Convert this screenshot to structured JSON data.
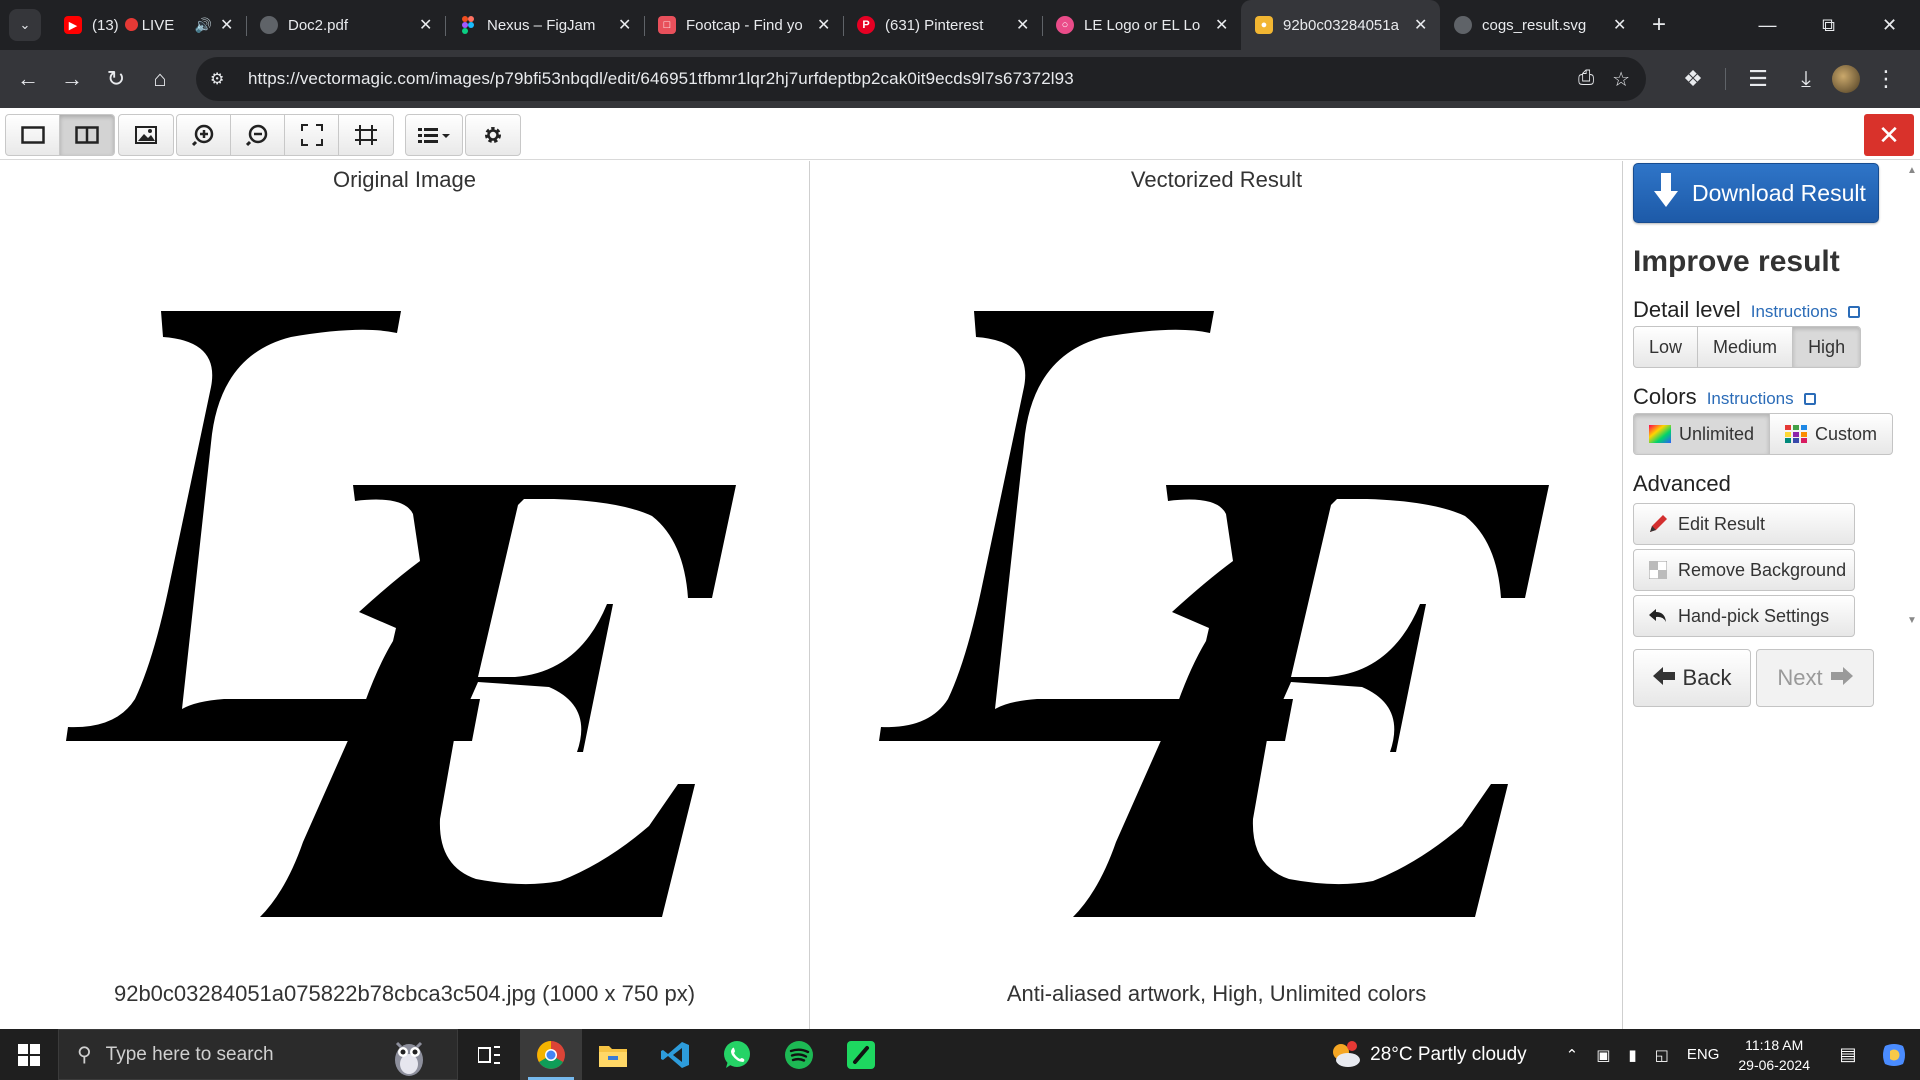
{
  "browser": {
    "tabs": [
      {
        "title": "(13)",
        "live_label": "LIVE",
        "favicon": "youtube-icon",
        "color": "#ff0000"
      },
      {
        "title": "Doc2.pdf",
        "favicon": "globe-icon",
        "color": "#9aa0a6"
      },
      {
        "title": "Nexus – FigJam",
        "favicon": "figma-icon",
        "color": "#a259ff"
      },
      {
        "title": "Footcap - Find yo",
        "favicon": "footcap-icon",
        "color": "#e8505b"
      },
      {
        "title": "(631) Pinterest",
        "favicon": "pinterest-icon",
        "color": "#e60023"
      },
      {
        "title": "LE Logo or EL Lo",
        "favicon": "dribbble-icon",
        "color": "#ea4c89"
      },
      {
        "title": "92b0c03284051a",
        "favicon": "vectormagic-icon",
        "color": "#f2b632",
        "active": true
      },
      {
        "title": "cogs_result.svg",
        "favicon": "globe-icon",
        "color": "#9aa0a6"
      }
    ],
    "url": "https://vectormagic.com/images/p79bfi53nbqdl/edit/646951tfbmr1lqr2hj7urfdeptbp2cak0it9ecds9l7s67372l93"
  },
  "panels": {
    "left_title": "Original Image",
    "left_caption": "92b0c03284051a075822b78cbca3c504.jpg (1000 x 750 px)",
    "right_title": "Vectorized Result",
    "right_caption": "Anti-aliased artwork, High, Unlimited colors"
  },
  "sidebar": {
    "download_label": "Download Result",
    "improve_heading": "Improve result",
    "detail": {
      "label": "Detail level",
      "instructions": "Instructions",
      "options": [
        "Low",
        "Medium",
        "High"
      ],
      "selected": "High"
    },
    "colors": {
      "label": "Colors",
      "instructions": "Instructions",
      "options": [
        "Unlimited",
        "Custom"
      ],
      "selected": "Unlimited"
    },
    "advanced": {
      "label": "Advanced",
      "buttons": [
        "Edit Result",
        "Remove Background",
        "Hand-pick Settings"
      ]
    },
    "back_label": "Back",
    "next_label": "Next"
  },
  "taskbar": {
    "search_placeholder": "Type here to search",
    "weather": "28°C  Partly cloudy",
    "language": "ENG",
    "time": "11:18 AM",
    "date": "29-06-2024"
  }
}
